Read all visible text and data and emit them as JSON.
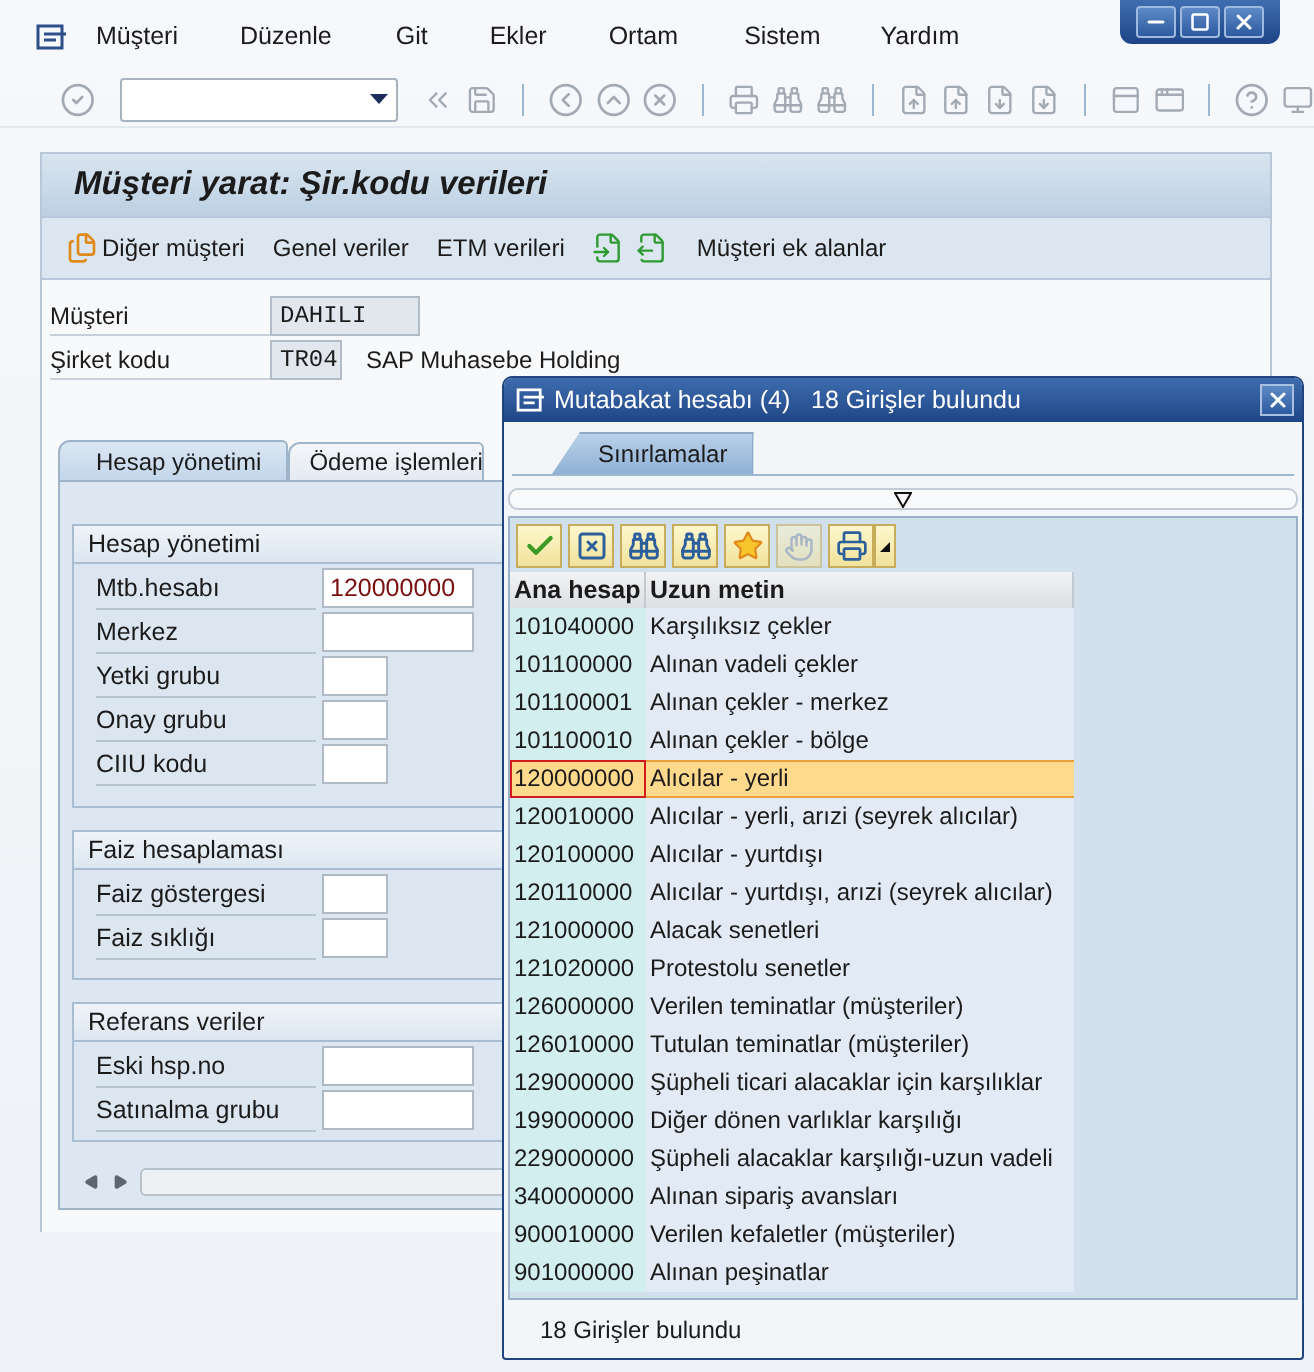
{
  "menu": [
    "Müşteri",
    "Düzenle",
    "Git",
    "Ekler",
    "Ortam",
    "Sistem",
    "Yardım"
  ],
  "screen_title": "Müşteri yarat: Şir.kodu verileri",
  "app_toolbar": [
    {
      "kind": "icon-text",
      "label": "Diğer müşteri"
    },
    {
      "kind": "text",
      "label": "Genel veriler"
    },
    {
      "kind": "text",
      "label": "ETM verileri"
    },
    {
      "kind": "back"
    },
    {
      "kind": "forward"
    },
    {
      "kind": "text",
      "label": "Müşteri ek alanlar"
    }
  ],
  "header_fields": [
    {
      "label": "Müşteri",
      "value": "DAHILI"
    },
    {
      "label": "Şirket kodu",
      "value": "TR04",
      "description": "SAP Muhasebe Holding"
    }
  ],
  "tabs": [
    {
      "label": "Hesap yönetimi",
      "selected": true
    },
    {
      "label": "Ödeme işlemleri",
      "selected": false
    }
  ],
  "groups": [
    {
      "title": "Hesap yönetimi",
      "fields": [
        {
          "label": "Mtb.hesabı",
          "kind": "long",
          "value": "120000000"
        },
        {
          "label": "Merkez",
          "kind": "long"
        },
        {
          "label": "Yetki grubu",
          "kind": "short"
        },
        {
          "label": "Onay grubu",
          "kind": "short"
        },
        {
          "label": "CIIU kodu",
          "kind": "short"
        }
      ]
    },
    {
      "title": "Faiz hesaplaması",
      "fields": [
        {
          "label": "Faiz göstergesi",
          "kind": "short"
        },
        {
          "label": "Faiz sıklığı",
          "kind": "short"
        }
      ]
    },
    {
      "title": "Referans veriler",
      "fields": [
        {
          "label": "Eski hsp.no",
          "kind": "long"
        },
        {
          "label": "Satınalma grubu",
          "kind": "long"
        }
      ]
    }
  ],
  "dialog": {
    "title": "Mutabakat hesabı (4)   18 Girişler bulundu",
    "tabs": [
      {
        "label": "Sınırlamalar",
        "selected": true
      }
    ],
    "columns": [
      "Ana hesap",
      "Uzun metin"
    ],
    "rows": [
      {
        "account": "101040000",
        "text": "Karşılıksız çekler",
        "selected": false
      },
      {
        "account": "101100000",
        "text": "Alınan vadeli çekler",
        "selected": false
      },
      {
        "account": "101100001",
        "text": "Alınan çekler - merkez",
        "selected": false
      },
      {
        "account": "101100010",
        "text": "Alınan çekler - bölge",
        "selected": false
      },
      {
        "account": "120000000",
        "text": "Alıcılar - yerli",
        "selected": true
      },
      {
        "account": "120010000",
        "text": "Alıcılar - yerli, arızi (seyrek alıcılar)",
        "selected": false
      },
      {
        "account": "120100000",
        "text": "Alıcılar - yurtdışı",
        "selected": false
      },
      {
        "account": "120110000",
        "text": "Alıcılar - yurtdışı, arızi (seyrek alıcılar)",
        "selected": false
      },
      {
        "account": "121000000",
        "text": "Alacak senetleri",
        "selected": false
      },
      {
        "account": "121020000",
        "text": "Protestolu senetler",
        "selected": false
      },
      {
        "account": "126000000",
        "text": "Verilen teminatlar (müşteriler)",
        "selected": false
      },
      {
        "account": "126010000",
        "text": "Tutulan teminatlar (müşteriler)",
        "selected": false
      },
      {
        "account": "129000000",
        "text": "Şüpheli ticari alacaklar için karşılıklar",
        "selected": false
      },
      {
        "account": "199000000",
        "text": "Diğer dönen varlıklar karşılığı",
        "selected": false
      },
      {
        "account": "229000000",
        "text": "Şüpheli alacaklar karşılığı-uzun vadeli",
        "selected": false
      },
      {
        "account": "340000000",
        "text": "Alınan sipariş avansları",
        "selected": false
      },
      {
        "account": "900010000",
        "text": "Verilen kefaletler (müşteriler)",
        "selected": false
      },
      {
        "account": "901000000",
        "text": "Alınan peşinatlar",
        "selected": false
      }
    ],
    "status": "18 Girişler bulundu"
  }
}
